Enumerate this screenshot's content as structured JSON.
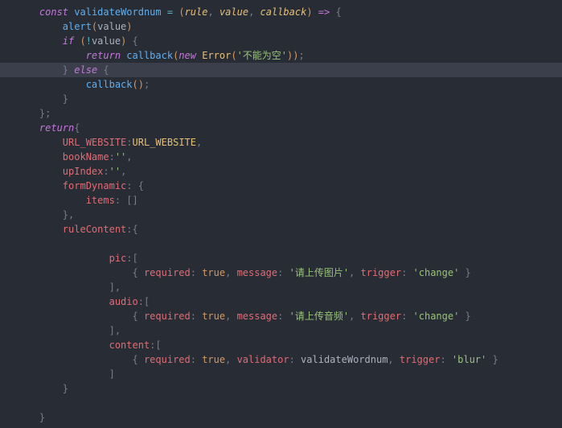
{
  "lines": [
    {
      "indent": 4,
      "hl": false,
      "tokens": [
        {
          "t": "const ",
          "c": "t-key"
        },
        {
          "t": "validateWordnum",
          "c": "t-fn"
        },
        {
          "t": " ",
          "c": "t-plain"
        },
        {
          "t": "=",
          "c": "t-op"
        },
        {
          "t": " ",
          "c": "t-plain"
        },
        {
          "t": "(",
          "c": "t-punc-paren"
        },
        {
          "t": "rule",
          "c": "t-param"
        },
        {
          "t": ", ",
          "c": "t-punc"
        },
        {
          "t": "value",
          "c": "t-param"
        },
        {
          "t": ", ",
          "c": "t-punc"
        },
        {
          "t": "callback",
          "c": "t-param"
        },
        {
          "t": ")",
          "c": "t-punc-paren"
        },
        {
          "t": " ",
          "c": "t-plain"
        },
        {
          "t": "=>",
          "c": "t-key-ni"
        },
        {
          "t": " ",
          "c": "t-plain"
        },
        {
          "t": "{",
          "c": "t-punc"
        }
      ]
    },
    {
      "indent": 8,
      "hl": false,
      "tokens": [
        {
          "t": "alert",
          "c": "t-fn"
        },
        {
          "t": "(",
          "c": "t-punc-paren"
        },
        {
          "t": "value",
          "c": "t-plain"
        },
        {
          "t": ")",
          "c": "t-punc-paren"
        }
      ]
    },
    {
      "indent": 8,
      "hl": false,
      "tokens": [
        {
          "t": "if ",
          "c": "t-key"
        },
        {
          "t": "(",
          "c": "t-punc-paren"
        },
        {
          "t": "!",
          "c": "t-op"
        },
        {
          "t": "value",
          "c": "t-plain"
        },
        {
          "t": ")",
          "c": "t-punc-paren"
        },
        {
          "t": " ",
          "c": "t-plain"
        },
        {
          "t": "{",
          "c": "t-punc"
        }
      ]
    },
    {
      "indent": 12,
      "hl": false,
      "tokens": [
        {
          "t": "return ",
          "c": "t-key"
        },
        {
          "t": "callback",
          "c": "t-fn"
        },
        {
          "t": "(",
          "c": "t-punc-paren"
        },
        {
          "t": "new ",
          "c": "t-key"
        },
        {
          "t": "Error",
          "c": "t-var"
        },
        {
          "t": "(",
          "c": "t-punc-paren"
        },
        {
          "t": "'不能为空'",
          "c": "t-str"
        },
        {
          "t": ")",
          "c": "t-punc-paren"
        },
        {
          "t": ")",
          "c": "t-punc-paren"
        },
        {
          "t": ";",
          "c": "t-punc"
        }
      ]
    },
    {
      "indent": 8,
      "hl": true,
      "tokens": [
        {
          "t": "}",
          "c": "t-punc"
        },
        {
          "t": " ",
          "c": "t-plain"
        },
        {
          "t": "else ",
          "c": "t-key"
        },
        {
          "t": "{",
          "c": "t-punc"
        }
      ]
    },
    {
      "indent": 12,
      "hl": false,
      "tokens": [
        {
          "t": "callback",
          "c": "t-fn"
        },
        {
          "t": "(",
          "c": "t-punc-paren"
        },
        {
          "t": ")",
          "c": "t-punc-paren"
        },
        {
          "t": ";",
          "c": "t-punc"
        }
      ]
    },
    {
      "indent": 8,
      "hl": false,
      "tokens": [
        {
          "t": "}",
          "c": "t-punc"
        }
      ]
    },
    {
      "indent": 4,
      "hl": false,
      "tokens": [
        {
          "t": "}",
          "c": "t-punc"
        },
        {
          "t": ";",
          "c": "t-punc"
        }
      ]
    },
    {
      "indent": 4,
      "hl": false,
      "tokens": [
        {
          "t": "return",
          "c": "t-key"
        },
        {
          "t": "{",
          "c": "t-punc"
        }
      ]
    },
    {
      "indent": 8,
      "hl": false,
      "tokens": [
        {
          "t": "URL_WEBSITE",
          "c": "t-prop"
        },
        {
          "t": ":",
          "c": "t-punc"
        },
        {
          "t": "URL_WEBSITE",
          "c": "t-var"
        },
        {
          "t": ",",
          "c": "t-punc"
        }
      ]
    },
    {
      "indent": 8,
      "hl": false,
      "tokens": [
        {
          "t": "bookName",
          "c": "t-prop"
        },
        {
          "t": ":",
          "c": "t-punc"
        },
        {
          "t": "''",
          "c": "t-str"
        },
        {
          "t": ",",
          "c": "t-punc"
        }
      ]
    },
    {
      "indent": 8,
      "hl": false,
      "tokens": [
        {
          "t": "upIndex",
          "c": "t-prop"
        },
        {
          "t": ":",
          "c": "t-punc"
        },
        {
          "t": "''",
          "c": "t-str"
        },
        {
          "t": ",",
          "c": "t-punc"
        }
      ]
    },
    {
      "indent": 8,
      "hl": false,
      "tokens": [
        {
          "t": "formDynamic",
          "c": "t-prop"
        },
        {
          "t": ": ",
          "c": "t-punc"
        },
        {
          "t": "{",
          "c": "t-punc"
        }
      ]
    },
    {
      "indent": 12,
      "hl": false,
      "tokens": [
        {
          "t": "items",
          "c": "t-prop"
        },
        {
          "t": ": ",
          "c": "t-punc"
        },
        {
          "t": "[",
          "c": "t-punc"
        },
        {
          "t": "]",
          "c": "t-punc"
        }
      ]
    },
    {
      "indent": 8,
      "hl": false,
      "tokens": [
        {
          "t": "}",
          "c": "t-punc"
        },
        {
          "t": ",",
          "c": "t-punc"
        }
      ]
    },
    {
      "indent": 8,
      "hl": false,
      "tokens": [
        {
          "t": "ruleContent",
          "c": "t-prop"
        },
        {
          "t": ":",
          "c": "t-punc"
        },
        {
          "t": "{",
          "c": "t-punc"
        }
      ]
    },
    {
      "indent": 0,
      "hl": false,
      "tokens": []
    },
    {
      "indent": 16,
      "hl": false,
      "tokens": [
        {
          "t": "pic",
          "c": "t-prop"
        },
        {
          "t": ":",
          "c": "t-punc"
        },
        {
          "t": "[",
          "c": "t-punc"
        }
      ]
    },
    {
      "indent": 20,
      "hl": false,
      "tokens": [
        {
          "t": "{ ",
          "c": "t-punc"
        },
        {
          "t": "required",
          "c": "t-prop"
        },
        {
          "t": ": ",
          "c": "t-punc"
        },
        {
          "t": "true",
          "c": "t-bool"
        },
        {
          "t": ", ",
          "c": "t-punc"
        },
        {
          "t": "message",
          "c": "t-prop"
        },
        {
          "t": ": ",
          "c": "t-punc"
        },
        {
          "t": "'请上传图片'",
          "c": "t-str"
        },
        {
          "t": ", ",
          "c": "t-punc"
        },
        {
          "t": "trigger",
          "c": "t-prop"
        },
        {
          "t": ": ",
          "c": "t-punc"
        },
        {
          "t": "'change'",
          "c": "t-str"
        },
        {
          "t": " }",
          "c": "t-punc"
        }
      ]
    },
    {
      "indent": 16,
      "hl": false,
      "tokens": [
        {
          "t": "]",
          "c": "t-punc"
        },
        {
          "t": ",",
          "c": "t-punc"
        }
      ]
    },
    {
      "indent": 16,
      "hl": false,
      "tokens": [
        {
          "t": "audio",
          "c": "t-prop"
        },
        {
          "t": ":",
          "c": "t-punc"
        },
        {
          "t": "[",
          "c": "t-punc"
        }
      ]
    },
    {
      "indent": 20,
      "hl": false,
      "tokens": [
        {
          "t": "{ ",
          "c": "t-punc"
        },
        {
          "t": "required",
          "c": "t-prop"
        },
        {
          "t": ": ",
          "c": "t-punc"
        },
        {
          "t": "true",
          "c": "t-bool"
        },
        {
          "t": ", ",
          "c": "t-punc"
        },
        {
          "t": "message",
          "c": "t-prop"
        },
        {
          "t": ": ",
          "c": "t-punc"
        },
        {
          "t": "'请上传音频'",
          "c": "t-str"
        },
        {
          "t": ", ",
          "c": "t-punc"
        },
        {
          "t": "trigger",
          "c": "t-prop"
        },
        {
          "t": ": ",
          "c": "t-punc"
        },
        {
          "t": "'change'",
          "c": "t-str"
        },
        {
          "t": " }",
          "c": "t-punc"
        }
      ]
    },
    {
      "indent": 16,
      "hl": false,
      "tokens": [
        {
          "t": "]",
          "c": "t-punc"
        },
        {
          "t": ",",
          "c": "t-punc"
        }
      ]
    },
    {
      "indent": 16,
      "hl": false,
      "tokens": [
        {
          "t": "content",
          "c": "t-prop"
        },
        {
          "t": ":",
          "c": "t-punc"
        },
        {
          "t": "[",
          "c": "t-punc"
        }
      ]
    },
    {
      "indent": 20,
      "hl": false,
      "tokens": [
        {
          "t": "{ ",
          "c": "t-punc"
        },
        {
          "t": "required",
          "c": "t-prop"
        },
        {
          "t": ": ",
          "c": "t-punc"
        },
        {
          "t": "true",
          "c": "t-bool"
        },
        {
          "t": ", ",
          "c": "t-punc"
        },
        {
          "t": "validator",
          "c": "t-prop"
        },
        {
          "t": ": ",
          "c": "t-punc"
        },
        {
          "t": "validateWordnum",
          "c": "t-plain"
        },
        {
          "t": ", ",
          "c": "t-punc"
        },
        {
          "t": "trigger",
          "c": "t-prop"
        },
        {
          "t": ": ",
          "c": "t-punc"
        },
        {
          "t": "'blur'",
          "c": "t-str"
        },
        {
          "t": " }",
          "c": "t-punc"
        }
      ]
    },
    {
      "indent": 16,
      "hl": false,
      "tokens": [
        {
          "t": "]",
          "c": "t-punc"
        }
      ]
    },
    {
      "indent": 8,
      "hl": false,
      "tokens": [
        {
          "t": "}",
          "c": "t-punc"
        }
      ]
    },
    {
      "indent": 0,
      "hl": false,
      "tokens": []
    },
    {
      "indent": 4,
      "hl": false,
      "tokens": [
        {
          "t": "}",
          "c": "t-punc"
        }
      ]
    }
  ]
}
